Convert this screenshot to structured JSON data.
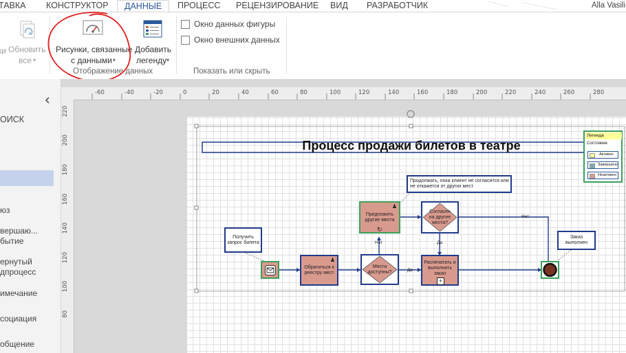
{
  "ribbon": {
    "tabs": [
      {
        "label": "ТАВКА"
      },
      {
        "label": "КОНСТРУКТОР"
      },
      {
        "label": "ДАННЫЕ"
      },
      {
        "label": "ПРОЦЕСС"
      },
      {
        "label": "РЕЦЕНЗИРОВАНИЕ"
      },
      {
        "label": "ВИД"
      },
      {
        "label": "РАЗРАБОТЧИК"
      }
    ],
    "user": "Alla Vasili",
    "refresh": {
      "line1": "Обновить",
      "line2": "все"
    },
    "refresh_partial": "ки",
    "data_graphics": {
      "line1": "Рисунки, связанные",
      "line2": "с данными"
    },
    "add_legend": {
      "line1": "Добавить",
      "line2": "легенду"
    },
    "group_display": "Отображение данных",
    "chk_shape_data": "Окно данных фигуры",
    "chk_external_data": "Окно внешних данных",
    "group_show_hide": "Показать или скрыть"
  },
  "left_pane": {
    "search": "ОИСК",
    "items": [
      "юз",
      "вершаю...",
      "бытие",
      "ернутый",
      "дпроцесс",
      "имечание",
      "социация",
      "общение"
    ]
  },
  "ruler": {
    "h": [
      "-60",
      "-40",
      "-20",
      "0",
      "20",
      "40",
      "60",
      "80",
      "100",
      "120",
      "140",
      "160",
      "180",
      "200",
      "220",
      "240",
      "260",
      "280"
    ],
    "v": [
      "220",
      "200",
      "180",
      "160",
      "140",
      "120",
      "100",
      "80"
    ]
  },
  "diagram": {
    "title": "Процесс продажи билетов в театре",
    "legend": {
      "title": "Легенда",
      "state": "Состояние",
      "active": "Активно",
      "done": "Завершено",
      "inactive": "Неактивно"
    },
    "note_receive": "Получить запрос билета",
    "note_continue": "Продолжать, пока клиент не согласится или не откажется от других мест",
    "note_done": "Заказ выполнен",
    "task_registry": "Обратиться к реестру мест",
    "task_offer": "Предложить другие места",
    "task_print": "Распечатать и выполнить заказ",
    "gw_available": "Места доступны?",
    "gw_agree": "Согласен на другие места?",
    "lbl_no1": "Нет",
    "lbl_yes1": "Да",
    "lbl_no2": "Нет",
    "lbl_yes2": "Да"
  }
}
